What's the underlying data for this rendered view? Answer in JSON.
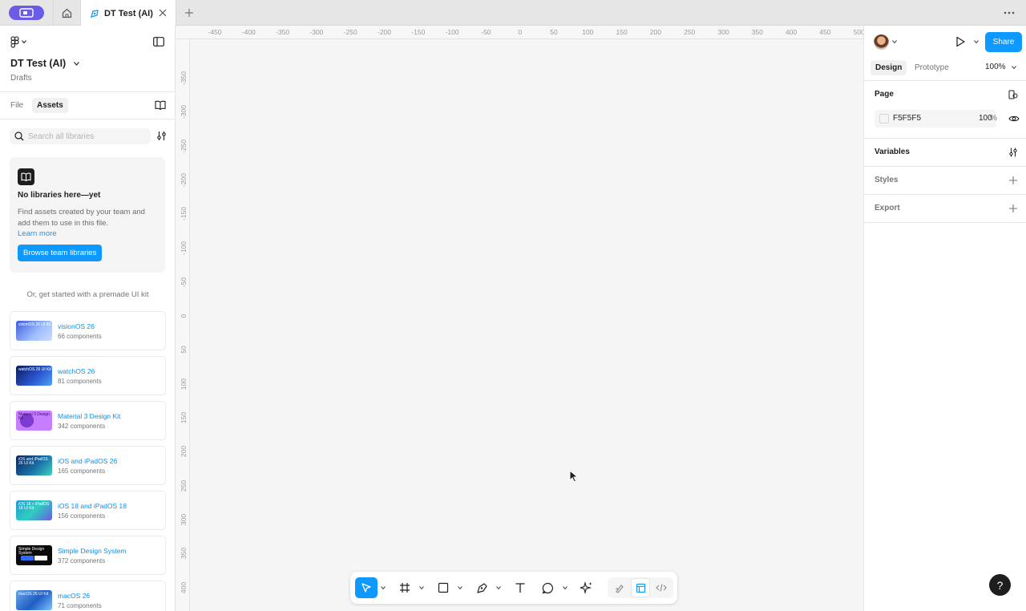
{
  "tabs": {
    "active_title": "DT Test (AI)"
  },
  "left_panel": {
    "file_name": "DT Test (AI)",
    "file_location": "Drafts",
    "tab_file": "File",
    "tab_assets": "Assets",
    "search_placeholder": "Search all libraries",
    "empty": {
      "title": "No libraries here—yet",
      "description": "Find assets created by your team and add them to use in this file.",
      "link": "Learn more",
      "button": "Browse team libraries"
    },
    "premade_hint": "Or, get started with a premade UI kit",
    "kits": [
      {
        "name": "visionOS 26",
        "count": "66 components",
        "thumb_text": "visionOS 26 UI Kit"
      },
      {
        "name": "watchOS 26",
        "count": "81 components",
        "thumb_text": "watchOS 26 UI Kit"
      },
      {
        "name": "Material 3 Design Kit",
        "count": "342 components",
        "thumb_text": "Material 3 Design Kit"
      },
      {
        "name": "iOS and iPadOS 26",
        "count": "165 components",
        "thumb_text": "iOS and iPadOS 26 UI Kit"
      },
      {
        "name": "iOS 18 and iPadOS 18",
        "count": "156 components",
        "thumb_text": "iOS 18 + iPadOS 18 UI Kit"
      },
      {
        "name": "Simple Design System",
        "count": "372 components",
        "thumb_text": "Simple Design System"
      },
      {
        "name": "macOS 26",
        "count": "71 components",
        "thumb_text": "macOS 26 UI Kit"
      }
    ]
  },
  "rulers": {
    "top": [
      "-450",
      "-400",
      "-350",
      "-300",
      "-250",
      "-200",
      "-150",
      "-100",
      "-50",
      "0",
      "50",
      "100",
      "150",
      "200",
      "250",
      "300",
      "350",
      "400",
      "450",
      "500"
    ],
    "left": [
      "-350",
      "-300",
      "-250",
      "-200",
      "-150",
      "-100",
      "-50",
      "0",
      "50",
      "100",
      "150",
      "200",
      "250",
      "300",
      "350",
      "400"
    ]
  },
  "right_panel": {
    "share": "Share",
    "tab_design": "Design",
    "tab_prototype": "Prototype",
    "zoom": "100%",
    "page_label": "Page",
    "page_color": "F5F5F5",
    "page_opacity": "100",
    "page_opacity_unit": "%",
    "variables_label": "Variables",
    "styles_label": "Styles",
    "export_label": "Export"
  },
  "help": "?",
  "colors": {
    "accent": "#0d99ff",
    "app_pill": "#6b5ce7",
    "canvas": "#f5f5f5"
  }
}
